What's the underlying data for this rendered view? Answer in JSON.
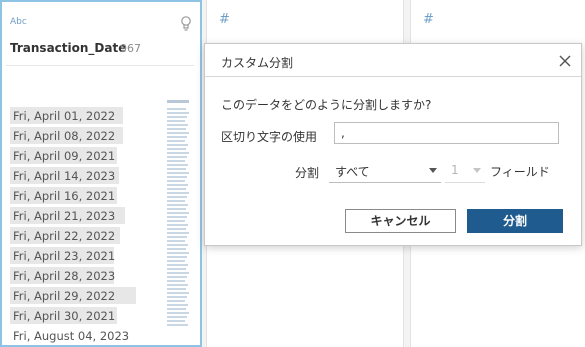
{
  "profile_cards": [
    {
      "type_label": "Abc",
      "field_name": "Transaction_Date",
      "distinct_count": "967",
      "values": [
        {
          "text": "Fri, April 01, 2022",
          "fill": 0.78
        },
        {
          "text": "Fri, April 08, 2022",
          "fill": 0.78
        },
        {
          "text": "Fri, April 09, 2021",
          "fill": 0.74
        },
        {
          "text": "Fri, April 14, 2023",
          "fill": 0.75
        },
        {
          "text": "Fri, April 16, 2021",
          "fill": 0.74
        },
        {
          "text": "Fri, April 21, 2023",
          "fill": 0.79
        },
        {
          "text": "Fri, April 22, 2022",
          "fill": 0.76
        },
        {
          "text": "Fri, April 23, 2021",
          "fill": 0.72
        },
        {
          "text": "Fri, April 28, 2023",
          "fill": 0.72
        },
        {
          "text": "Fri, April 29, 2022",
          "fill": 0.87
        },
        {
          "text": "Fri, April 30, 2021",
          "fill": 0.74
        },
        {
          "text": "Fri, August 04, 2023",
          "fill": 0.0
        }
      ]
    },
    {
      "type_label": "#"
    },
    {
      "type_label": "#"
    }
  ],
  "dialog": {
    "title": "カスタム分割",
    "question": "このデータをどのように分割しますか?",
    "delimiter_label": "区切り文字の使用",
    "delimiter_value": ",",
    "split_label": "分割",
    "split_option": "すべて",
    "field_count": "1",
    "fields_label": "フィールド",
    "cancel_label": "キャンセル",
    "split_button_label": "分割"
  },
  "icons": {
    "close": "close-icon",
    "bulb": "lightbulb-icon",
    "caret": "caret-down-icon"
  },
  "colors": {
    "primary_button": "#1f5b8e",
    "selected_card_border": "#8fc3e3",
    "type_icon": "#6f9fc7"
  }
}
